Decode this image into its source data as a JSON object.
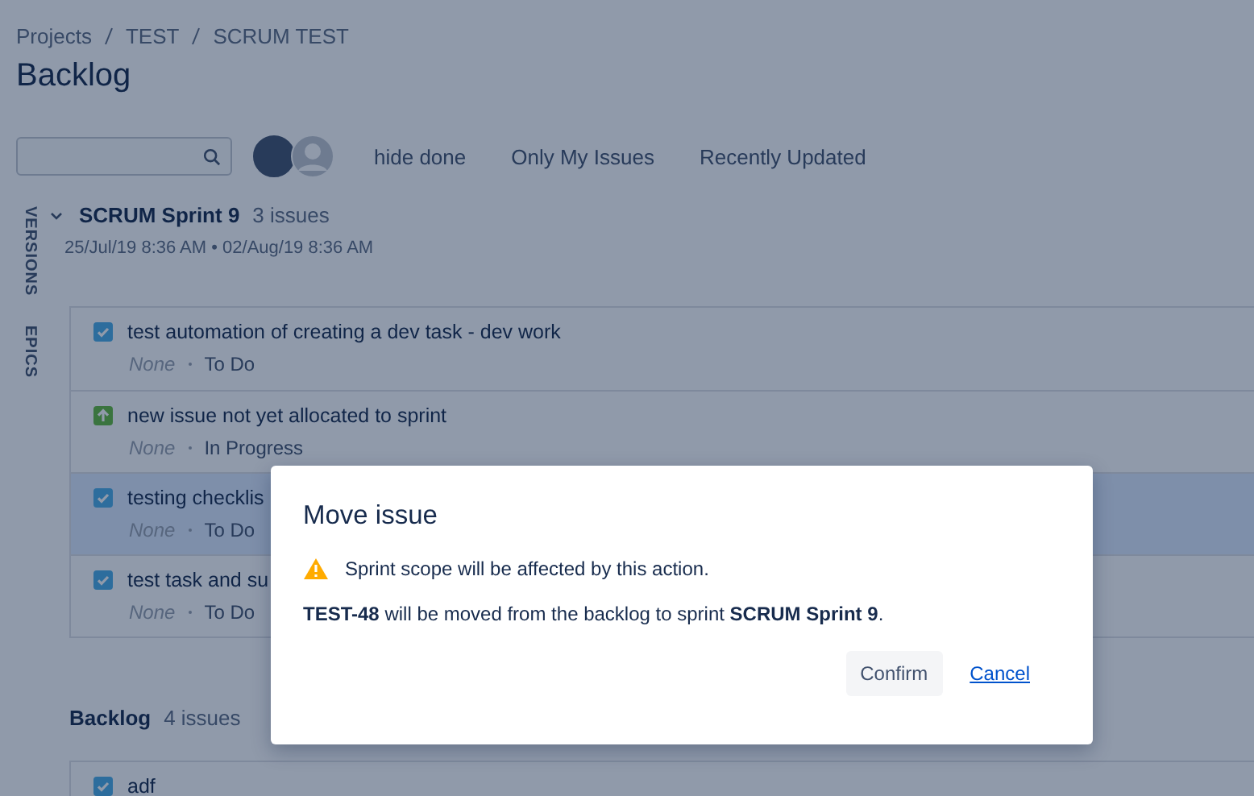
{
  "breadcrumbs": [
    "Projects",
    "TEST",
    "SCRUM TEST"
  ],
  "title": "Backlog",
  "toolbar": {
    "filters": [
      "hide done",
      "Only My Issues",
      "Recently Updated"
    ]
  },
  "side_tabs": [
    "VERSIONS",
    "EPICS"
  ],
  "sprint": {
    "name": "SCRUM Sprint 9",
    "count": "3 issues",
    "dates": "25/Jul/19 8:36 AM • 02/Aug/19 8:36 AM",
    "expanded": true,
    "issues": [
      {
        "kind": "task",
        "summary": "test automation of creating a dev task - dev work",
        "epic": "None",
        "status": "To Do",
        "selected": false
      },
      {
        "kind": "story",
        "summary": "new issue not yet allocated to sprint",
        "epic": "None",
        "status": "In Progress",
        "selected": false
      },
      {
        "kind": "task",
        "summary": "testing checklis",
        "epic": "None",
        "status": "To Do",
        "selected": true
      },
      {
        "kind": "task",
        "summary": "test task and su",
        "epic": "None",
        "status": "To Do",
        "selected": false
      }
    ]
  },
  "backlog": {
    "name": "Backlog",
    "count": "4 issues",
    "issues": [
      {
        "kind": "task",
        "summary": "adf",
        "selected": false
      }
    ]
  },
  "dialog": {
    "title": "Move issue",
    "warning": "Sprint scope will be affected by this action.",
    "message": "**TEST-48** will be moved from the backlog to sprint **SCRUM Sprint 9**.",
    "buttons": [
      "Confirm",
      "Cancel"
    ]
  }
}
